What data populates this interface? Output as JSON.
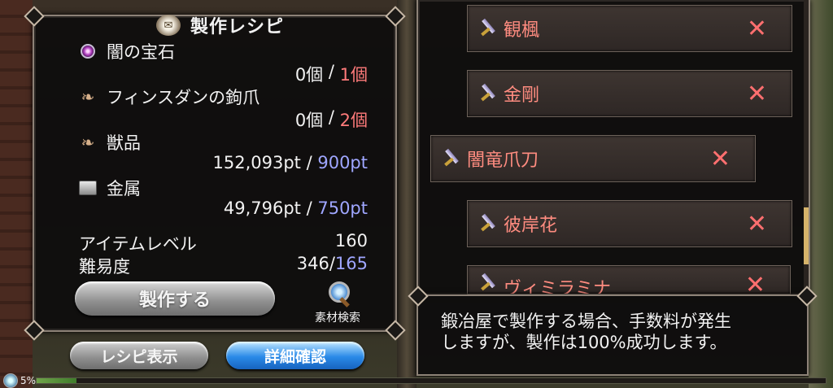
{
  "title": {
    "text": "製作レシピ",
    "icon": "scroll-icon"
  },
  "materials": [
    {
      "name": "闇の宝石",
      "icon": "dark-gem-icon",
      "owned": "0個",
      "required": "1個",
      "required_color": "#ff7b7b"
    },
    {
      "name": "フィンスダンの鉤爪",
      "icon": "claw-icon",
      "owned": "0個",
      "required": "2個",
      "required_color": "#ff7b7b"
    },
    {
      "name": "獣品",
      "icon": "claw-icon",
      "owned": "152,093pt",
      "required": "900pt",
      "required_color": "#9fa6ff"
    },
    {
      "name": "金属",
      "icon": "metal-ingot-icon",
      "owned": "49,796pt",
      "required": "750pt",
      "required_color": "#9fa6ff"
    }
  ],
  "separator": " / ",
  "stats": {
    "item_level_label": "アイテムレベル",
    "item_level_value": "160",
    "difficulty_label": "難易度",
    "difficulty_value": "346/",
    "difficulty_required": "165"
  },
  "buttons": {
    "craft": "製作する",
    "material_search": "素材検索",
    "show_recipe": "レシピ表示",
    "details": "詳細確認"
  },
  "weapons": [
    {
      "name": "観楓",
      "icon": "sword-icon"
    },
    {
      "name": "金剛",
      "icon": "sword-icon"
    },
    {
      "name": "闇竜爪刀",
      "icon": "sword-icon"
    },
    {
      "name": "彼岸花",
      "icon": "sword-icon"
    },
    {
      "name": "ヴィミラミナ",
      "icon": "sword-icon"
    }
  ],
  "remove_mark": "✕",
  "info": "鍛冶屋で製作する場合、手数料が発生\nしますが、製作は100%成功します。",
  "status": {
    "text": "5%",
    "progress": 0.05
  },
  "colors": {
    "accent_red": "#ff7b7b",
    "accent_blue": "#9fa6ff",
    "weapon_name": "#ff8c80"
  }
}
